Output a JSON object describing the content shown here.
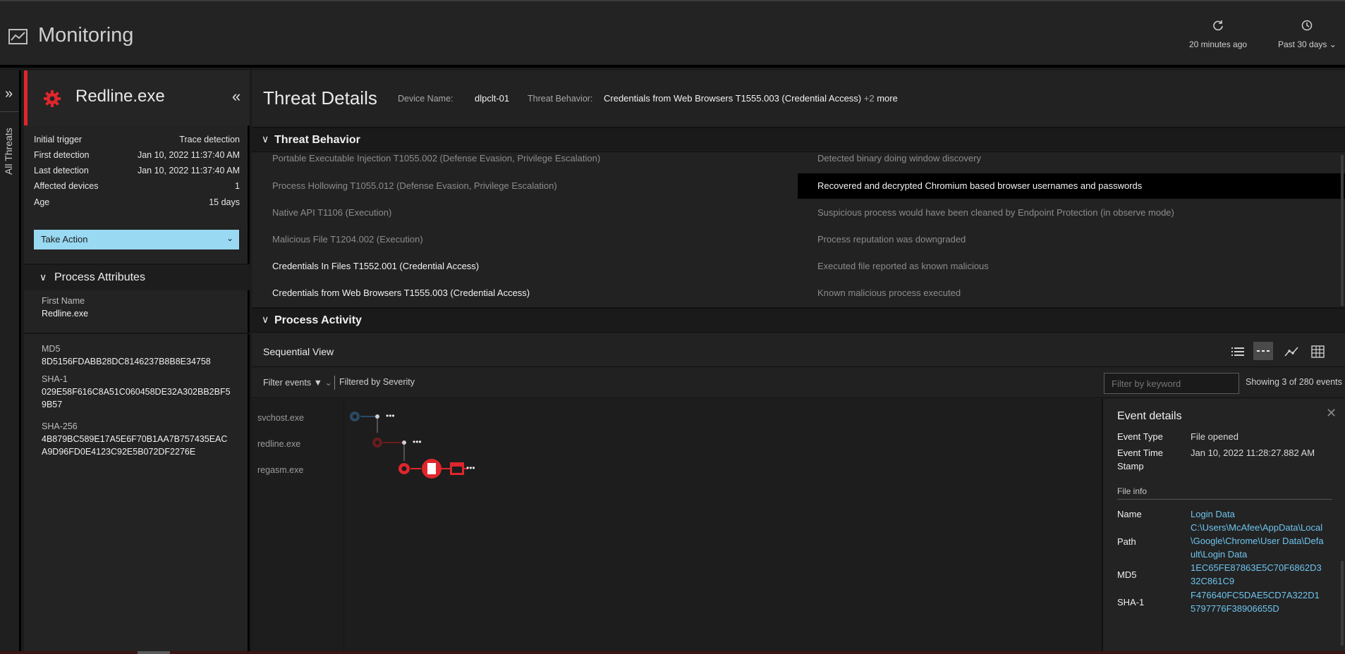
{
  "app": {
    "title": "Monitoring",
    "refresh_label": "20 minutes ago",
    "range_label": "Past 30 days"
  },
  "rail": {
    "label": "All Threats"
  },
  "threat": {
    "name": "Redline.exe",
    "rows": [
      {
        "label": "Initial trigger",
        "value": "Trace detection"
      },
      {
        "label": "First detection",
        "value": "Jan 10, 2022 11:37:40 AM"
      },
      {
        "label": "Last detection",
        "value": "Jan 10, 2022 11:37:40 AM"
      },
      {
        "label": "Affected devices",
        "value": "1"
      },
      {
        "label": "Age",
        "value": "15 days"
      }
    ],
    "take_action": "Take Action"
  },
  "process_attributes": {
    "title": "Process Attributes",
    "first_name_label": "First Name",
    "first_name": "Redline.exe",
    "md5_label": "MD5",
    "md5": "8D5156FDABB28DC8146237B8B8E34758",
    "sha1_label": "SHA-1",
    "sha1": "029E58F616C8A51C060458DE32A302BB2BF59B57",
    "sha256_label": "SHA-256",
    "sha256": "4B879BC589E17A5E6F70B1AA7B757435EACA9D96FD0E4123C92E5B072DF2276E"
  },
  "details_header": {
    "title": "Threat Details",
    "device_label": "Device Name:",
    "device": "dlpclt-01",
    "behavior_label": "Threat Behavior:",
    "behavior": "Credentials from Web Browsers T1555.003 (Credential Access)",
    "more_count": "+2",
    "more": "more"
  },
  "threat_behavior": {
    "title": "Threat Behavior",
    "left": [
      "Portable Executable Injection T1055.002 (Defense Evasion, Privilege Escalation)",
      "Process Hollowing T1055.012 (Defense Evasion, Privilege Escalation)",
      "Native API T1106 (Execution)",
      "Malicious File T1204.002 (Execution)",
      "Credentials In Files T1552.001 (Credential Access)",
      "Credentials from Web Browsers T1555.003 (Credential Access)"
    ],
    "right": [
      "Detected binary doing window discovery",
      "Recovered and decrypted Chromium based browser usernames and passwords",
      "Suspicious process would have been cleaned by Endpoint Protection (in observe mode)",
      "Process reputation was downgraded",
      "Executed file reported as known malicious",
      "Known malicious process executed"
    ]
  },
  "process_activity": {
    "title": "Process Activity",
    "view_title": "Sequential View",
    "filter_events": "Filter events",
    "filtered_by": "Filtered by Severity",
    "keyword_placeholder": "Filter by keyword",
    "showing": "Showing 3 of 280 events",
    "lanes": [
      "svchost.exe",
      "redline.exe",
      "regasm.exe"
    ]
  },
  "event_details": {
    "title": "Event details",
    "event_type_label": "Event Type",
    "event_type": "File opened",
    "timestamp_label": "Event Time Stamp",
    "timestamp": "Jan 10, 2022 11:28:27.882 AM",
    "file_info": "File info",
    "name_label": "Name",
    "name": "Login Data",
    "path_label": "Path",
    "path": "C:\\Users\\McAfee\\AppData\\Local\\Google\\Chrome\\User Data\\Default\\Login Data",
    "md5_label": "MD5",
    "md5": "1EC65FE87863E5C70F6862D332C861C9",
    "sha1_label": "SHA-1",
    "sha1": "F476640FC5DAE5CD7A322D15797776F38906655D"
  },
  "colors": {
    "accent_red": "#e0262c",
    "action_blue": "#99d9f2",
    "link": "#6ec4ee"
  }
}
